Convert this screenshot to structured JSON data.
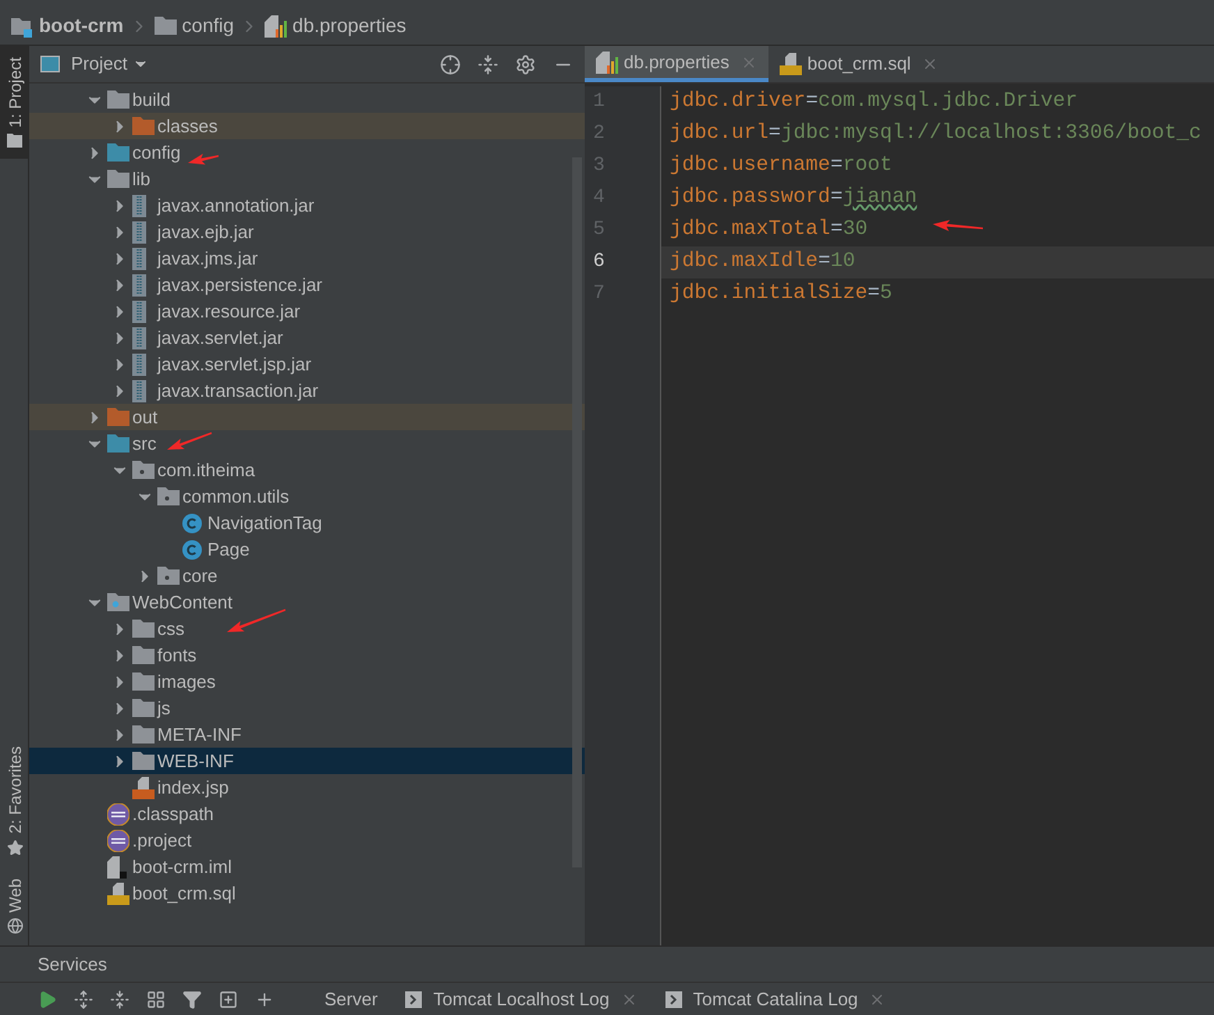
{
  "breadcrumb": [
    {
      "label": "boot-crm",
      "kind": "module"
    },
    {
      "label": "config",
      "kind": "folder"
    },
    {
      "label": "db.properties",
      "kind": "properties"
    }
  ],
  "tool_strip": [
    {
      "label": "1: Project",
      "selected": true,
      "kind": "folder"
    },
    {
      "label": "2: Favorites",
      "selected": false,
      "kind": "star"
    },
    {
      "label": "Web",
      "selected": false,
      "kind": "globe"
    }
  ],
  "project_panel": {
    "title": "Project",
    "tree": [
      {
        "label": "build",
        "kind": "folder",
        "expanded": true,
        "excluded": false,
        "selected": false,
        "children": [
          {
            "label": "classes",
            "kind": "excluded_folder",
            "expanded": false,
            "excluded": true,
            "selected": false
          }
        ]
      },
      {
        "label": "config",
        "kind": "source_folder",
        "expanded": false,
        "excluded": false,
        "selected": false
      },
      {
        "label": "lib",
        "kind": "folder",
        "expanded": true,
        "excluded": false,
        "selected": false,
        "children": [
          {
            "label": "javax.annotation.jar",
            "kind": "jar",
            "expanded": false,
            "excluded": false,
            "selected": false
          },
          {
            "label": "javax.ejb.jar",
            "kind": "jar",
            "expanded": false,
            "excluded": false,
            "selected": false
          },
          {
            "label": "javax.jms.jar",
            "kind": "jar",
            "expanded": false,
            "excluded": false,
            "selected": false
          },
          {
            "label": "javax.persistence.jar",
            "kind": "jar",
            "expanded": false,
            "excluded": false,
            "selected": false
          },
          {
            "label": "javax.resource.jar",
            "kind": "jar",
            "expanded": false,
            "excluded": false,
            "selected": false
          },
          {
            "label": "javax.servlet.jar",
            "kind": "jar",
            "expanded": false,
            "excluded": false,
            "selected": false
          },
          {
            "label": "javax.servlet.jsp.jar",
            "kind": "jar",
            "expanded": false,
            "excluded": false,
            "selected": false
          },
          {
            "label": "javax.transaction.jar",
            "kind": "jar",
            "expanded": false,
            "excluded": false,
            "selected": false
          }
        ]
      },
      {
        "label": "out",
        "kind": "excluded_folder",
        "expanded": false,
        "excluded": true,
        "selected": false
      },
      {
        "label": "src",
        "kind": "source_folder",
        "expanded": true,
        "excluded": false,
        "selected": false,
        "children": [
          {
            "label": "com.itheima",
            "kind": "package",
            "expanded": true,
            "excluded": false,
            "selected": false,
            "children": [
              {
                "label": "common.utils",
                "kind": "package",
                "expanded": true,
                "excluded": false,
                "selected": false,
                "children": [
                  {
                    "label": "NavigationTag",
                    "kind": "class",
                    "excluded": false,
                    "selected": false
                  },
                  {
                    "label": "Page",
                    "kind": "class",
                    "excluded": false,
                    "selected": false
                  }
                ]
              },
              {
                "label": "core",
                "kind": "package",
                "expanded": false,
                "excluded": false,
                "selected": false
              }
            ]
          }
        ]
      },
      {
        "label": "WebContent",
        "kind": "web_folder",
        "expanded": true,
        "excluded": false,
        "selected": false,
        "children": [
          {
            "label": "css",
            "kind": "folder",
            "expanded": false,
            "excluded": false,
            "selected": false
          },
          {
            "label": "fonts",
            "kind": "folder",
            "expanded": false,
            "excluded": false,
            "selected": false
          },
          {
            "label": "images",
            "kind": "folder",
            "expanded": false,
            "excluded": false,
            "selected": false
          },
          {
            "label": "js",
            "kind": "folder",
            "expanded": false,
            "excluded": false,
            "selected": false
          },
          {
            "label": "META-INF",
            "kind": "folder",
            "expanded": false,
            "excluded": false,
            "selected": false
          },
          {
            "label": "WEB-INF",
            "kind": "folder",
            "expanded": false,
            "excluded": false,
            "selected": true
          },
          {
            "label": "index.jsp",
            "kind": "jsp",
            "excluded": false,
            "selected": false
          }
        ]
      },
      {
        "label": ".classpath",
        "kind": "eclipse",
        "excluded": false,
        "selected": false
      },
      {
        "label": ".project",
        "kind": "eclipse",
        "excluded": false,
        "selected": false
      },
      {
        "label": "boot-crm.iml",
        "kind": "iml",
        "excluded": false,
        "selected": false
      },
      {
        "label": "boot_crm.sql",
        "kind": "sql",
        "excluded": false,
        "selected": false
      }
    ]
  },
  "editor_tabs": [
    {
      "label": "db.properties",
      "kind": "properties",
      "selected": true
    },
    {
      "label": "boot_crm.sql",
      "kind": "sql",
      "selected": false
    }
  ],
  "code_lines": [
    {
      "number": "1",
      "key": "jdbc.driver",
      "separator": "=",
      "value": "com.mysql.jdbc.Driver",
      "current": false,
      "typo": false
    },
    {
      "number": "2",
      "key": "jdbc.url",
      "separator": "=",
      "value": "jdbc:mysql://localhost:3306/boot_c",
      "current": false,
      "typo": false
    },
    {
      "number": "3",
      "key": "jdbc.username",
      "separator": "=",
      "value": "root",
      "current": false,
      "typo": false
    },
    {
      "number": "4",
      "key": "jdbc.password",
      "separator": "=",
      "value": "jianan",
      "current": false,
      "typo": true
    },
    {
      "number": "5",
      "key": "jdbc.maxTotal",
      "separator": "=",
      "value": "30",
      "current": false,
      "typo": false
    },
    {
      "number": "6",
      "key": "jdbc.maxIdle",
      "separator": "=",
      "value": "10",
      "current": true,
      "typo": false
    },
    {
      "number": "7",
      "key": "jdbc.initialSize",
      "separator": "=",
      "value": "5",
      "current": false,
      "typo": false
    }
  ],
  "services": {
    "title": "Services",
    "tabs": [
      {
        "label": "Server",
        "closable": false
      },
      {
        "label": "Tomcat Localhost Log",
        "closable": true
      },
      {
        "label": "Tomcat Catalina Log",
        "closable": true
      }
    ]
  }
}
